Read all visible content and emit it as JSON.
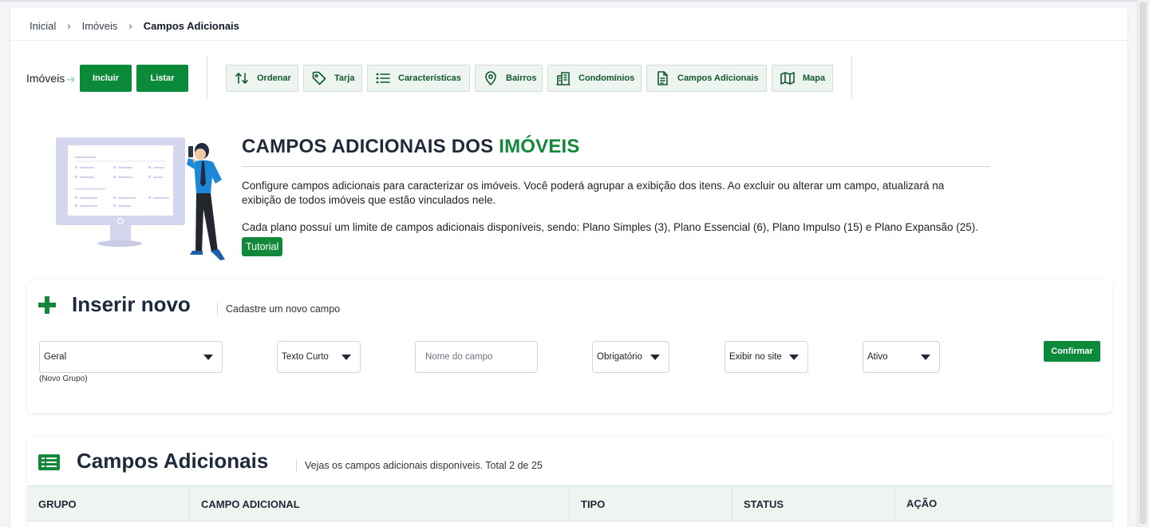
{
  "breadcrumb": {
    "items": [
      "Inicial",
      "Imóveis",
      "Campos Adicionais"
    ],
    "separator": "›"
  },
  "toolbar": {
    "section_label": "Imóveis",
    "include_label": "Incluir",
    "list_label": "Listar",
    "buttons": [
      {
        "label": "Ordenar",
        "icon": "sort-arrows-icon"
      },
      {
        "label": "Tarja",
        "icon": "tag-icon"
      },
      {
        "label": "Características",
        "icon": "list-icon"
      },
      {
        "label": "Bairros",
        "icon": "map-pin-icon"
      },
      {
        "label": "Condomínios",
        "icon": "building-icon"
      },
      {
        "label": "Campos Adicionais",
        "icon": "document-icon"
      },
      {
        "label": "Mapa",
        "icon": "map-icon"
      }
    ]
  },
  "hero": {
    "title_prefix": "CAMPOS ADICIONAIS DOS ",
    "title_accent": "IMÓVEIS",
    "paragraph1": "Configure campos adicionais para caracterizar os imóveis. Você poderá agrupar a exibição dos itens. Ao excluir ou alterar um campo, atualizará na exibição de todos imóveis que estão vinculados nele.",
    "paragraph2": "Cada plano possuí um limite de campos adicionais disponíveis, sendo: Plano Simples (3), Plano Essencial (6), Plano Impulso (15) e Plano Expansão (25).",
    "tutorial_label": "Tutorial"
  },
  "insert_panel": {
    "title": "Inserir novo",
    "subtitle": "Cadastre um novo campo",
    "group_select": "Geral",
    "group_note": "(Novo Grupo)",
    "type_select": "Texto Curto",
    "name_placeholder": "Nome do campo",
    "required_select": "Obrigatório",
    "site_select": "Exibir no site",
    "status_select": "Ativo",
    "confirm_label": "Confirmar"
  },
  "list_panel": {
    "title": "Campos Adicionais",
    "subtitle": "Vejas os campos adicionais disponíveis. Total 2 de 25",
    "columns": [
      "GRUPO",
      "CAMPO ADICIONAL",
      "TIPO",
      "STATUS",
      "AÇÃO"
    ]
  },
  "colors": {
    "accent": "#12893a",
    "primary_button": "#0b8a3a",
    "light_button_bg": "#eef4f0"
  }
}
